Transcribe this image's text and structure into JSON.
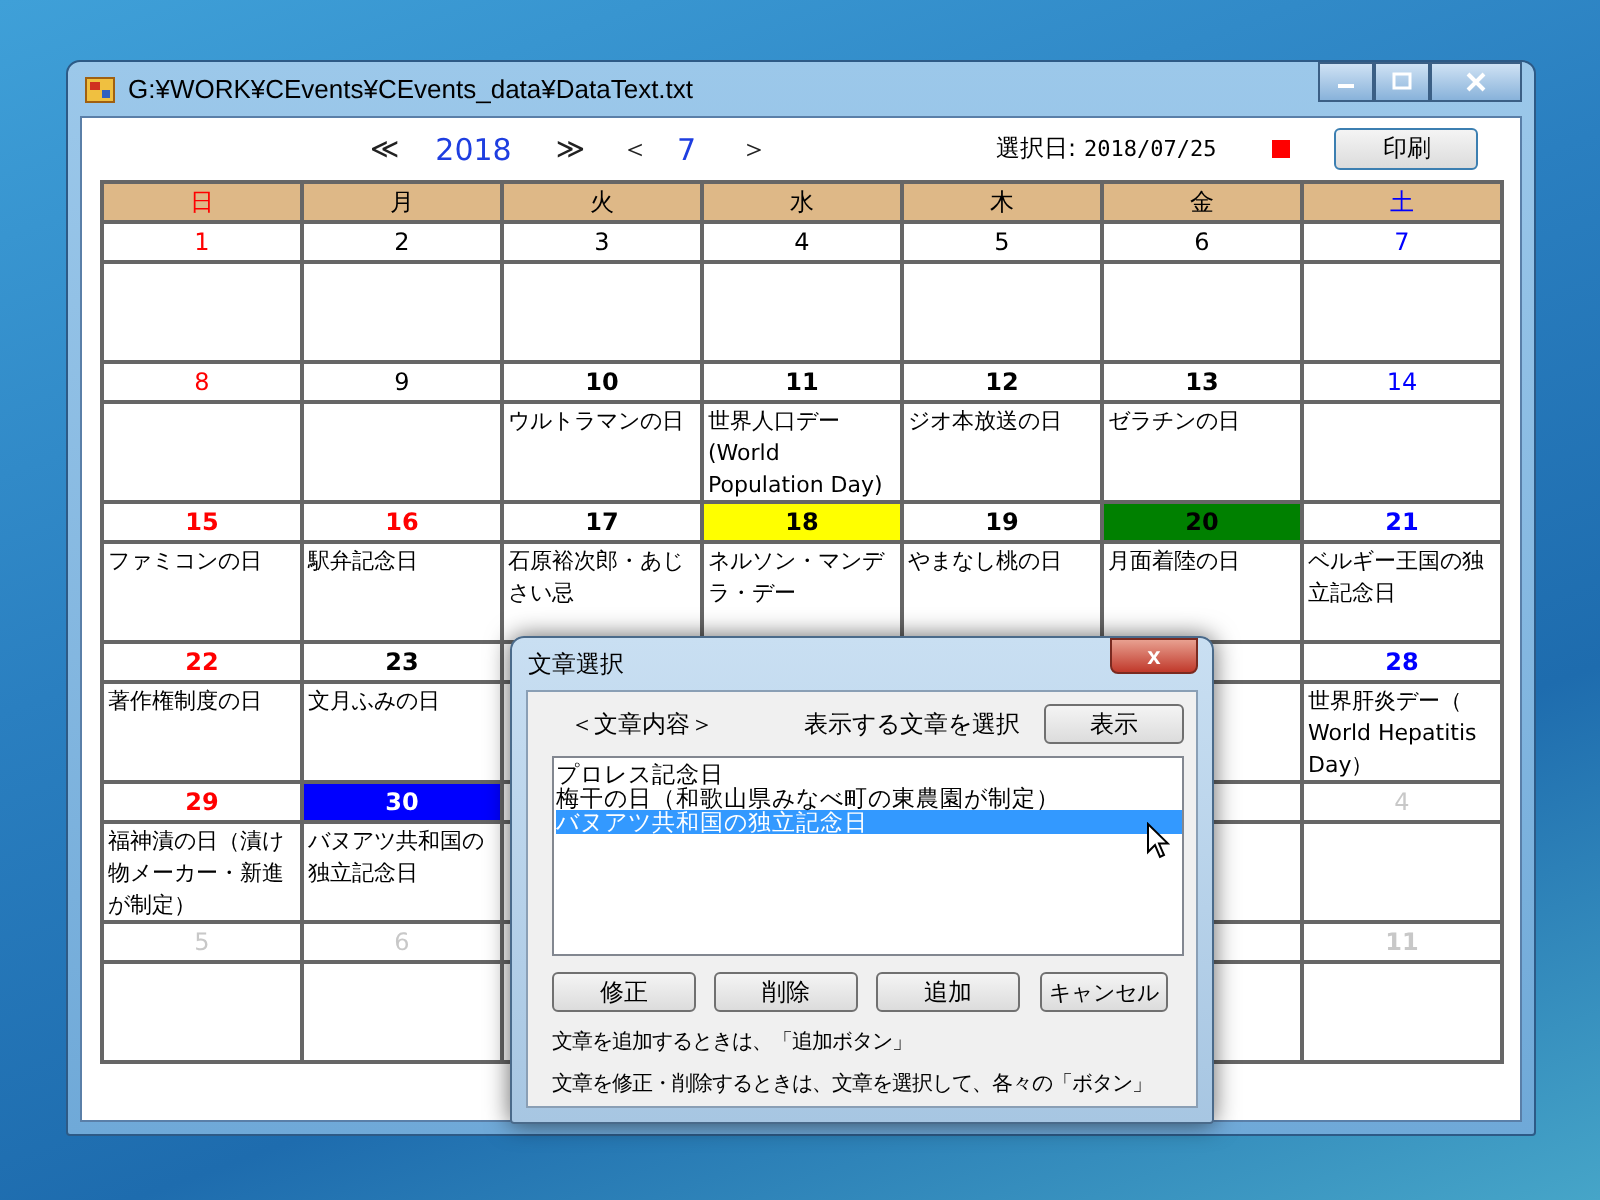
{
  "window": {
    "title": "G:¥WORK¥CEvents¥CEvents_data¥DataText.txt"
  },
  "nav": {
    "prev_year": "≪",
    "year": "2018",
    "next_year": "≫",
    "prev_month": "＜",
    "month": "7",
    "next_month": "＞"
  },
  "selected_date": {
    "label": "選択日:",
    "value": "2018/07/25",
    "color": "#ff0000"
  },
  "print_button": "印刷",
  "weekdays": [
    {
      "label": "日",
      "kind": "sunday"
    },
    {
      "label": "月",
      "kind": "weekday"
    },
    {
      "label": "火",
      "kind": "weekday"
    },
    {
      "label": "水",
      "kind": "weekday"
    },
    {
      "label": "木",
      "kind": "weekday"
    },
    {
      "label": "金",
      "kind": "weekday"
    },
    {
      "label": "土",
      "kind": "saturday"
    }
  ],
  "weeks": [
    {
      "days": [
        {
          "day": "1",
          "kind": "sunday",
          "bold": false
        },
        {
          "day": "2",
          "kind": "weekday",
          "bold": false
        },
        {
          "day": "3",
          "kind": "weekday",
          "bold": false
        },
        {
          "day": "4",
          "kind": "weekday",
          "bold": false
        },
        {
          "day": "5",
          "kind": "weekday",
          "bold": false
        },
        {
          "day": "6",
          "kind": "weekday",
          "bold": false
        },
        {
          "day": "7",
          "kind": "saturday",
          "bold": false
        }
      ]
    },
    {
      "days": [
        {
          "day": "8",
          "kind": "sunday",
          "bold": false
        },
        {
          "day": "9",
          "kind": "weekday",
          "bold": false
        },
        {
          "day": "10",
          "kind": "weekday",
          "bold": true,
          "event": "ウルトラマンの日"
        },
        {
          "day": "11",
          "kind": "weekday",
          "bold": true,
          "event": "世界人口デー (World Population Day)"
        },
        {
          "day": "12",
          "kind": "weekday",
          "bold": true,
          "event": "ジオ本放送の日"
        },
        {
          "day": "13",
          "kind": "weekday",
          "bold": true,
          "event": "ゼラチンの日"
        },
        {
          "day": "14",
          "kind": "saturday",
          "bold": false
        }
      ]
    },
    {
      "days": [
        {
          "day": "15",
          "kind": "sunday",
          "bold": true,
          "event": "ファミコンの日"
        },
        {
          "day": "16",
          "kind": "sunday",
          "bold": true,
          "event": "駅弁記念日"
        },
        {
          "day": "17",
          "kind": "weekday",
          "bold": true,
          "event": "石原裕次郎・あじさい忌"
        },
        {
          "day": "18",
          "kind": "weekday",
          "bold": true,
          "color": "#ffff00",
          "event": "ネルソン・マンデラ・デー"
        },
        {
          "day": "19",
          "kind": "weekday",
          "bold": true,
          "event": "やまなし桃の日"
        },
        {
          "day": "20",
          "kind": "weekday",
          "bold": true,
          "color": "#008000",
          "event": "月面着陸の日"
        },
        {
          "day": "21",
          "kind": "saturday",
          "bold": true,
          "event": "ベルギー王国の独立記念日"
        }
      ]
    },
    {
      "days": [
        {
          "day": "22",
          "kind": "sunday",
          "bold": true,
          "event": "著作権制度の日"
        },
        {
          "day": "23",
          "kind": "weekday",
          "bold": true,
          "event": "文月ふみの日"
        },
        {
          "kind": "covered"
        },
        {
          "kind": "covered"
        },
        {
          "kind": "covered"
        },
        {
          "kind": "covered"
        },
        {
          "day": "28",
          "kind": "saturday",
          "bold": true,
          "event": "世界肝炎デー（ World Hepatitis Day）"
        }
      ]
    },
    {
      "days": [
        {
          "day": "29",
          "kind": "sunday",
          "bold": true,
          "event": "福神漬の日（漬け物メーカー・新進が制定）"
        },
        {
          "day": "30",
          "kind": "weekday",
          "bold": true,
          "color": "#0000ff",
          "event": "バヌアツ共和国の独立記念日"
        },
        {
          "kind": "covered"
        },
        {
          "kind": "covered"
        },
        {
          "kind": "covered"
        },
        {
          "kind": "covered"
        },
        {
          "day": "4",
          "kind": "other_month",
          "bold": false
        }
      ]
    },
    {
      "days": [
        {
          "day": "5",
          "kind": "other_month",
          "bold": false
        },
        {
          "day": "6",
          "kind": "other_month",
          "bold": false
        },
        {
          "kind": "covered"
        },
        {
          "kind": "covered"
        },
        {
          "kind": "covered"
        },
        {
          "kind": "covered"
        },
        {
          "day": "11",
          "kind": "other_month",
          "bold": true
        }
      ]
    }
  ],
  "dialog": {
    "title": "文章選択",
    "close": "x",
    "content_label": "＜文章内容＞",
    "instruction": "表示する文章を選択",
    "show_button": "表示",
    "items": [
      {
        "text": "プロレス記念日",
        "selected": false
      },
      {
        "text": "梅干の日（和歌山県みなべ町の東農園が制定）",
        "selected": false
      },
      {
        "text": "バヌアツ共和国の独立記念日",
        "selected": true
      }
    ],
    "buttons": [
      "修正",
      "削除",
      "追加",
      "キャンセル"
    ],
    "notes": [
      "文章を追加するときは、「追加ボタン」",
      "文章を修正・削除するときは、文章を選択して、各々の「ボタン」"
    ]
  }
}
